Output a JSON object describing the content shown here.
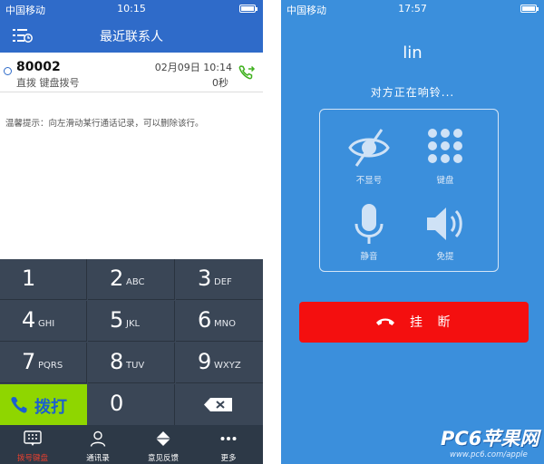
{
  "left": {
    "status": {
      "carrier": "中国移动",
      "time": "10:15"
    },
    "nav": {
      "title": "最近联系人"
    },
    "call": {
      "number": "80002",
      "subtitle": "直拨 键盘拨号",
      "date": "02月09日 10:14",
      "duration": "0秒"
    },
    "tip": "温馨提示：向左滑动某行通话记录，可以删除该行。",
    "keys": [
      {
        "digit": "1",
        "letters": ""
      },
      {
        "digit": "2",
        "letters": "ABC"
      },
      {
        "digit": "3",
        "letters": "DEF"
      },
      {
        "digit": "4",
        "letters": "GHI"
      },
      {
        "digit": "5",
        "letters": "JKL"
      },
      {
        "digit": "6",
        "letters": "MNO"
      },
      {
        "digit": "7",
        "letters": "PQRS"
      },
      {
        "digit": "8",
        "letters": "TUV"
      },
      {
        "digit": "9",
        "letters": "WXYZ"
      },
      {
        "digit": "0",
        "letters": ""
      }
    ],
    "dial_label": "拨打",
    "tabs": [
      {
        "label": "拨号键盘",
        "icon": "keypad-icon"
      },
      {
        "label": "通讯录",
        "icon": "contacts-icon"
      },
      {
        "label": "意见反馈",
        "icon": "feedback-icon"
      },
      {
        "label": "更多",
        "icon": "more-icon"
      }
    ],
    "colors": {
      "header": "#2f6bc9",
      "keypad": "#3a4656",
      "dial": "#8fd600",
      "active_tab": "#e8402f"
    }
  },
  "right": {
    "status": {
      "carrier": "中国移动",
      "time": "17:57"
    },
    "name": "lin",
    "state": "对方正在响铃...",
    "options": [
      {
        "label": "不显号",
        "icon": "eye-hidden-icon"
      },
      {
        "label": "键盘",
        "icon": "keypad-icon"
      },
      {
        "label": "静音",
        "icon": "microphone-icon"
      },
      {
        "label": "免提",
        "icon": "speaker-icon"
      }
    ],
    "hangup_label": "挂 断",
    "colors": {
      "background": "#3b8fdc",
      "hangup": "#f40f0f"
    }
  },
  "watermark": {
    "logo": "PC6苹果网",
    "url": "www.pc6.com/apple"
  }
}
